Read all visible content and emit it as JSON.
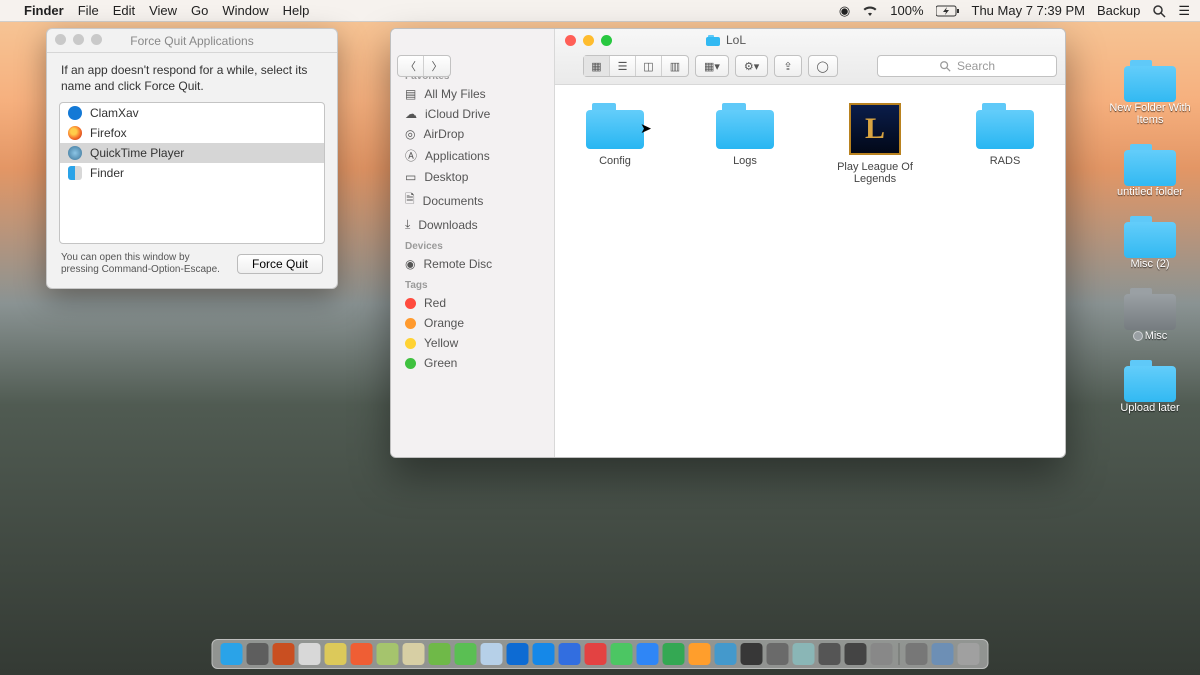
{
  "menubar": {
    "app": "Finder",
    "items": [
      "File",
      "Edit",
      "View",
      "Go",
      "Window",
      "Help"
    ],
    "battery": "100%",
    "datetime": "Thu May 7  7:39 PM",
    "extra": "Backup"
  },
  "desktop": {
    "items": [
      {
        "label": "New Folder With Items",
        "style": "blue"
      },
      {
        "label": "untitled folder",
        "style": "blue"
      },
      {
        "label": "Misc (2)",
        "style": "blue"
      },
      {
        "label": "Misc",
        "style": "gray",
        "dot": true
      },
      {
        "label": "Upload later",
        "style": "blue"
      }
    ]
  },
  "forcequit": {
    "title": "Force Quit Applications",
    "message": "If an app doesn't respond for a while, select its name and click Force Quit.",
    "apps": [
      {
        "name": "ClamXav",
        "color": "#1379d6",
        "selected": false
      },
      {
        "name": "Firefox",
        "color": "#f7742d",
        "selected": false
      },
      {
        "name": "QuickTime Player",
        "color": "#3b7397",
        "selected": true
      },
      {
        "name": "Finder",
        "color": "#2aa3e8",
        "selected": false
      }
    ],
    "hint": "You can open this window by pressing Command-Option-Escape.",
    "button": "Force Quit"
  },
  "finder": {
    "title": "LoL",
    "search_placeholder": "Search",
    "sidebar": {
      "favorites_header": "Favorites",
      "favorites": [
        "All My Files",
        "iCloud Drive",
        "AirDrop",
        "Applications",
        "Desktop",
        "Documents",
        "Downloads"
      ],
      "devices_header": "Devices",
      "devices": [
        "Remote Disc"
      ],
      "tags_header": "Tags",
      "tags": [
        {
          "label": "Red",
          "color": "#ff4b3e"
        },
        {
          "label": "Orange",
          "color": "#ff9a2e"
        },
        {
          "label": "Yellow",
          "color": "#ffd233"
        },
        {
          "label": "Green",
          "color": "#3fc13f"
        }
      ]
    },
    "items": [
      {
        "label": "Config",
        "type": "folder"
      },
      {
        "label": "Logs",
        "type": "folder"
      },
      {
        "label": "Play League Of Legends",
        "type": "app"
      },
      {
        "label": "RADS",
        "type": "folder"
      }
    ]
  },
  "dock": {
    "icons": [
      "#2aa3e8",
      "#5e5e5e",
      "#c94f21",
      "#d8d8d8",
      "#dcc95a",
      "#ef5e34",
      "#a5c46d",
      "#d7cfa4",
      "#6fb948",
      "#5abf53",
      "#b6d0e8",
      "#0d6bd3",
      "#1588e8",
      "#326ee0",
      "#e34242",
      "#4cc663",
      "#2f86f6",
      "#34a853",
      "#ff9e2c",
      "#4499cc",
      "#373737",
      "#6a6a6a",
      "#8ab6b6",
      "#555555",
      "#444444",
      "#888888",
      "#777777",
      "#6d8fb5",
      "#a0a0a0"
    ]
  }
}
